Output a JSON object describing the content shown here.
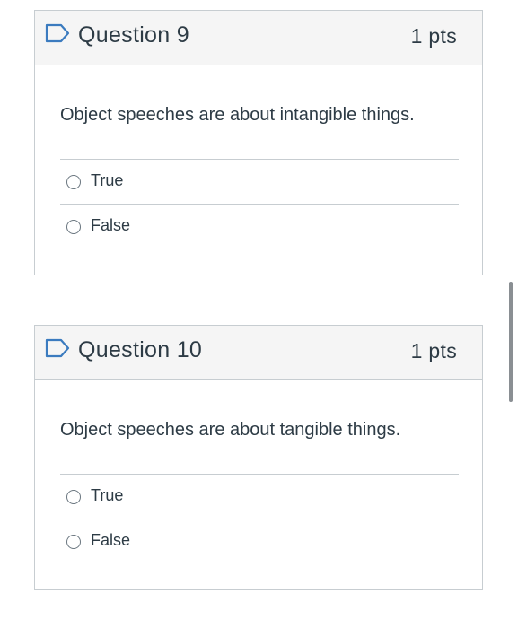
{
  "questions": [
    {
      "title": "Question 9",
      "points": "1 pts",
      "text": "Object speeches are about intangible things.",
      "answers": [
        {
          "label": "True"
        },
        {
          "label": "False"
        }
      ]
    },
    {
      "title": "Question 10",
      "points": "1 pts",
      "text": "Object speeches are about tangible things.",
      "answers": [
        {
          "label": "True"
        },
        {
          "label": "False"
        }
      ]
    }
  ],
  "colors": {
    "accent": "#3b7bbf",
    "text": "#2d3b45",
    "border": "#c7cdd1",
    "header_bg": "#f5f5f5"
  },
  "icons": {
    "flag": "flag-icon"
  }
}
